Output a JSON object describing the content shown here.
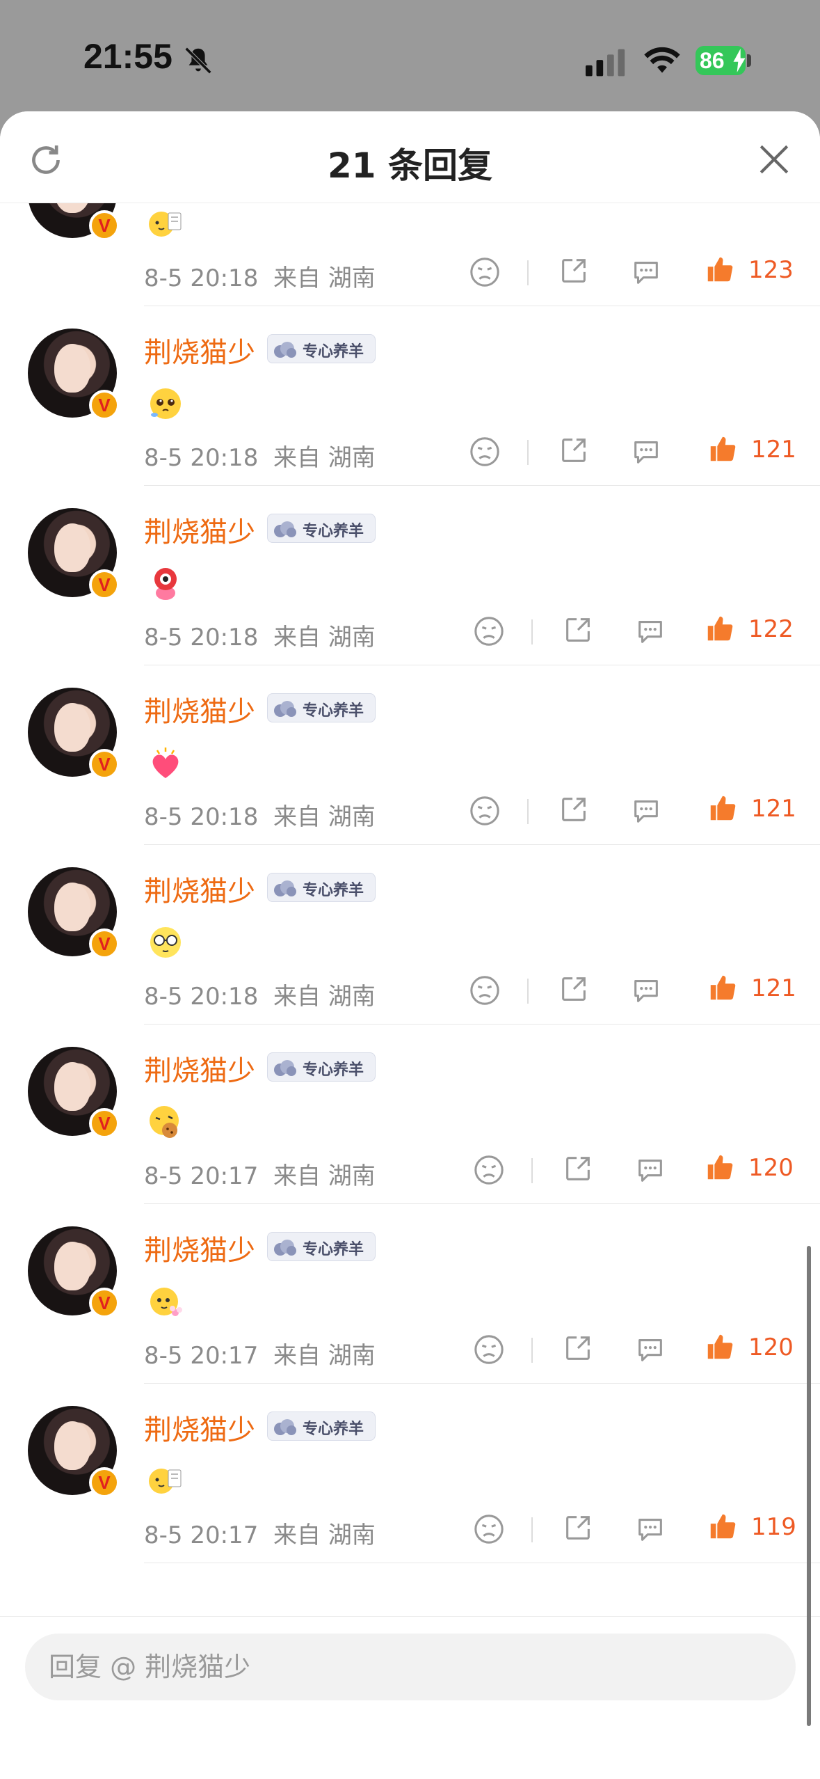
{
  "status": {
    "time": "21:55",
    "battery": "86",
    "icons": [
      "bell-muted-icon",
      "signal-icon",
      "wifi-icon",
      "battery-charging-icon"
    ]
  },
  "header": {
    "title": "21 条回复",
    "refresh_icon": "refresh-icon",
    "close_icon": "close-icon"
  },
  "tag_label": "专心养羊",
  "replies": [
    {
      "username": "荆烧猫少",
      "emoji": "emoji-sticker-holding-card",
      "date": "8-5 20:18",
      "location": "来自 湖南",
      "likes": "123"
    },
    {
      "username": "荆烧猫少",
      "emoji": "emoji-cute-pleading-face",
      "date": "8-5 20:18",
      "location": "来自 湖南",
      "likes": "121"
    },
    {
      "username": "荆烧猫少",
      "emoji": "emoji-red-eye-mascot",
      "date": "8-5 20:18",
      "location": "来自 湖南",
      "likes": "122"
    },
    {
      "username": "荆烧猫少",
      "emoji": "emoji-pink-heart",
      "date": "8-5 20:18",
      "location": "来自 湖南",
      "likes": "121"
    },
    {
      "username": "荆烧猫少",
      "emoji": "emoji-glasses-face",
      "date": "8-5 20:18",
      "location": "来自 湖南",
      "likes": "121"
    },
    {
      "username": "荆烧猫少",
      "emoji": "emoji-eating-cookie",
      "date": "8-5 20:17",
      "location": "来自 湖南",
      "likes": "120"
    },
    {
      "username": "荆烧猫少",
      "emoji": "emoji-flower-face",
      "date": "8-5 20:17",
      "location": "来自 湖南",
      "likes": "120"
    },
    {
      "username": "荆烧猫少",
      "emoji": "emoji-sticker-holding-card",
      "date": "8-5 20:17",
      "location": "来自 湖南",
      "likes": "119"
    }
  ],
  "footer": {
    "placeholder": "回复 @ 荆烧猫少"
  },
  "colors": {
    "username": "#ee6a12",
    "like": "#ee5a24",
    "meta": "#8a8a8a"
  }
}
